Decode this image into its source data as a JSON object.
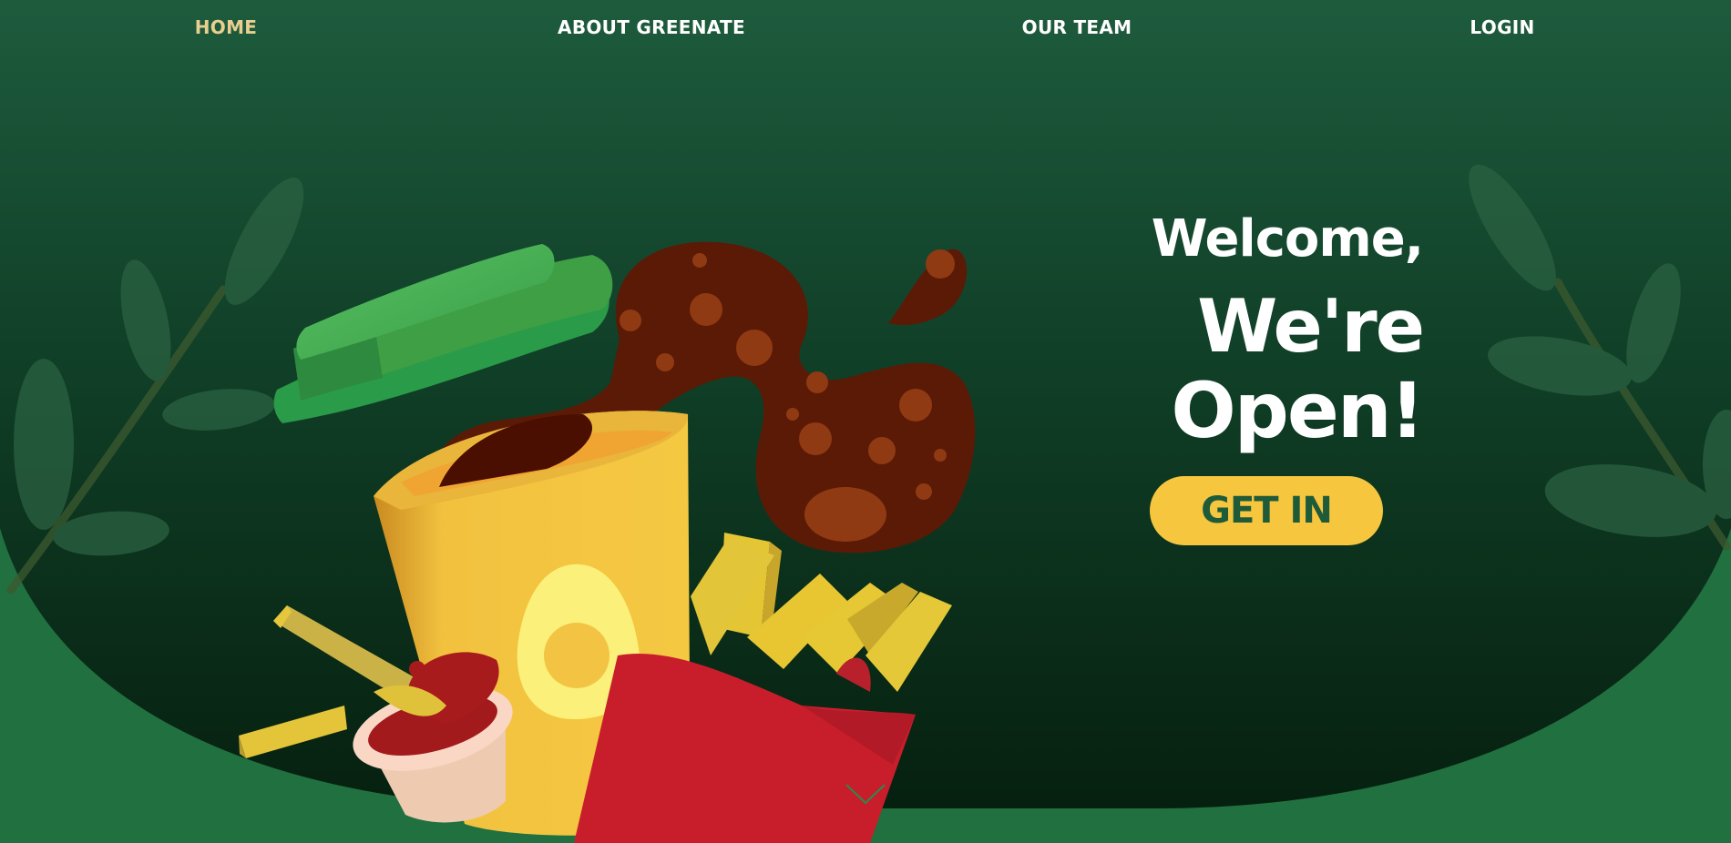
{
  "nav": {
    "items": [
      {
        "label": "HOME",
        "active": true
      },
      {
        "label": "ABOUT GREENATE",
        "active": false
      },
      {
        "label": "OUR TEAM",
        "active": false
      },
      {
        "label": "LOGIN",
        "active": false
      }
    ]
  },
  "hero": {
    "welcome_line1": "Welcome,",
    "welcome_line2": "We're",
    "welcome_line3": "Open!",
    "cta_label": "GET IN"
  },
  "illustration": {
    "subject": "food-combo-illustration",
    "items": [
      "cup-icon",
      "cup-lid-icon",
      "soda-splash-icon",
      "avocado-icon",
      "french-fries-icon",
      "ketchup-cup-icon",
      "leaf-icon"
    ]
  },
  "colors": {
    "accent": "#f6c63f",
    "nav_active": "#e9cf8f",
    "band": "#21703f",
    "hero_top": "#1e5b3d",
    "hero_bottom": "#06200f",
    "button_text": "#1f5b39"
  }
}
